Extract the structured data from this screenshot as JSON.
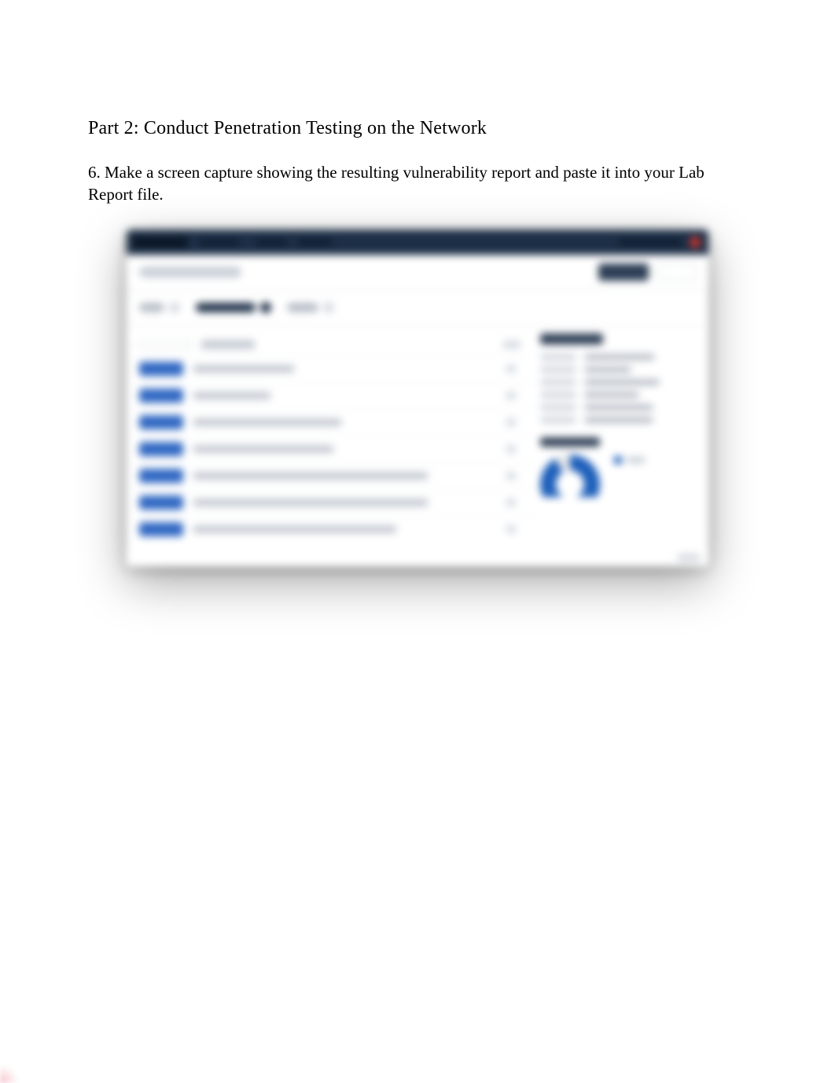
{
  "document": {
    "section_title": "Part 2: Conduct Penetration Testing on the Network",
    "instruction": "6. Make a screen capture showing the resulting vulnerability report and paste it into your Lab Report file."
  },
  "screenshot": {
    "app": "Nessus",
    "scan_name": "My Basic Network Scan",
    "buttons": {
      "configure": "Configure",
      "export": "Export"
    },
    "tabs": {
      "hosts": {
        "label": "Hosts",
        "count": 1
      },
      "vulnerabilities": {
        "label": "Vulnerabilities",
        "count": 38
      },
      "history": {
        "label": "History",
        "count": 1
      }
    },
    "columns": {
      "severity": "Severity",
      "name": "Plugin Name",
      "count": "Count"
    },
    "rows": [
      {
        "severity": "INFO",
        "name": "Nessus Scan Information",
        "count": 1
      },
      {
        "severity": "INFO",
        "name": "Nessus SYN scanner",
        "count": 1
      },
      {
        "severity": "INFO",
        "name": "SSL Certificate Information",
        "count": 1
      },
      {
        "severity": "INFO",
        "name": "SSL Cipher Suites Supported",
        "count": 1
      },
      {
        "severity": "INFO",
        "name": "SSL Certificate Signed Using Weak Hashing Algorithm (Known CA)",
        "count": 1
      },
      {
        "severity": "INFO",
        "name": "SSL Certificate Chain Contains Certificates Expiring Soon",
        "count": 1
      },
      {
        "severity": "INFO",
        "name": "SSL Certificate Chain Contains RSA Keys Less Than 2048 bits",
        "count": 1
      }
    ],
    "details": {
      "heading": "Scan Details",
      "name_label": "Name",
      "name_value": "My Basic Network Scan",
      "status_label": "Status",
      "status_value": "Completed",
      "policy_label": "Policy",
      "policy_value": "Basic Network Scan",
      "scanner_label": "Scanner",
      "scanner_value": "Local Scanner",
      "start_label": "Start",
      "start_value": "Today at 3:42 PM",
      "end_label": "End",
      "end_value": "Today at 3:48 PM",
      "elapsed_label": "Elapsed",
      "elapsed_value": "6 minutes"
    },
    "vuln_chart": {
      "heading": "Vulnerabilities",
      "legend": "Info"
    }
  },
  "chart_data": {
    "type": "pie",
    "title": "Vulnerabilities",
    "series": [
      {
        "name": "Info",
        "value": 38
      },
      {
        "name": "Other",
        "value": 0
      }
    ]
  }
}
